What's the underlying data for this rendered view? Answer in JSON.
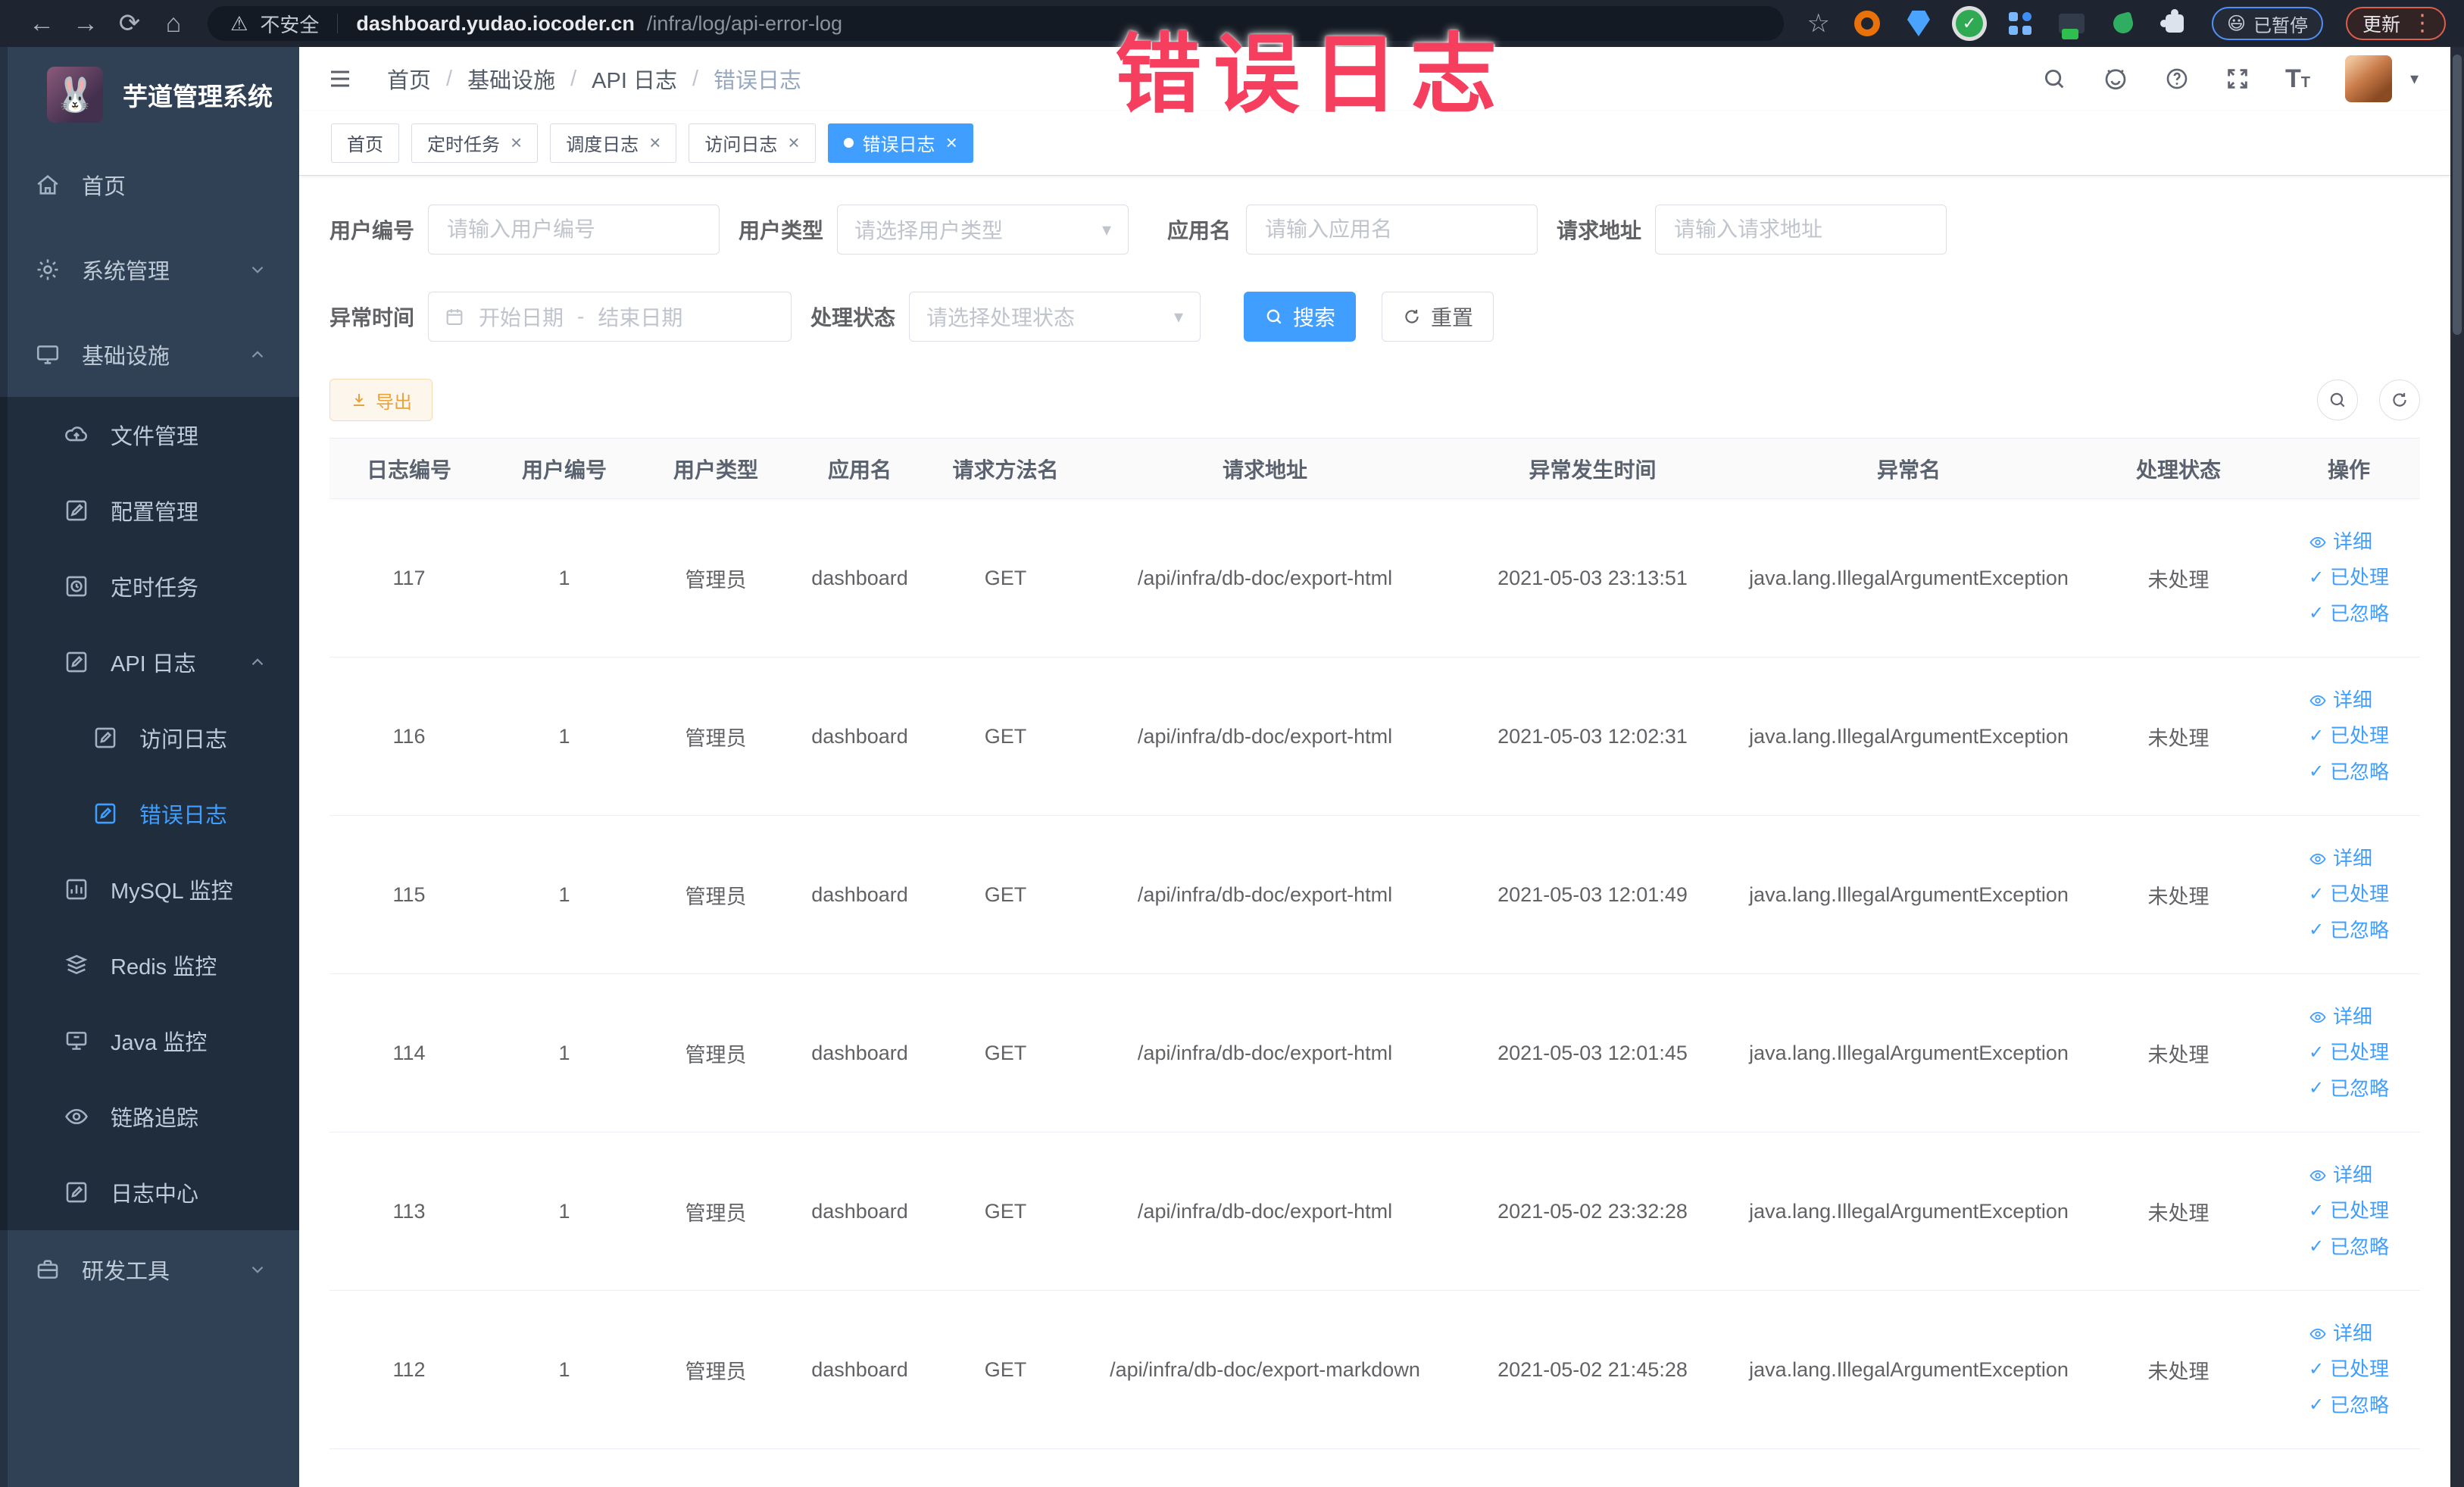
{
  "browser": {
    "security_label": "不安全",
    "url_host": "dashboard.yudao.iocoder.cn",
    "url_path": "/infra/log/api-error-log",
    "paused_emoji": "😃",
    "paused_label": "已暂停",
    "update_label": "更新"
  },
  "icons": {
    "nav_back": "←",
    "nav_forward": "→",
    "nav_reload": "⟳",
    "nav_home": "⌂",
    "security_warning": "⚠",
    "bookmark_star": "☆",
    "menu_kebab": "⋮",
    "dropdown_caret": "▾",
    "close": "×",
    "check": "✓",
    "breadcrumb_separator": "/"
  },
  "annotation": {
    "text": "错误日志",
    "color": "#f63e5e"
  },
  "header": {
    "breadcrumbs": [
      "首页",
      "基础设施",
      "API 日志",
      "错误日志"
    ],
    "font_size_glyph_big": "T",
    "font_size_glyph_small": "T"
  },
  "tabs": [
    {
      "label": "首页",
      "closable": false,
      "active": false
    },
    {
      "label": "定时任务",
      "closable": true,
      "active": false
    },
    {
      "label": "调度日志",
      "closable": true,
      "active": false
    },
    {
      "label": "访问日志",
      "closable": true,
      "active": false
    },
    {
      "label": "错误日志",
      "closable": true,
      "active": true
    }
  ],
  "sidebar": {
    "title": "芋道管理系统",
    "logo_emoji": "🐰",
    "items": [
      {
        "label": "首页"
      },
      {
        "label": "系统管理"
      },
      {
        "label": "基础设施"
      },
      {
        "label": "文件管理"
      },
      {
        "label": "配置管理"
      },
      {
        "label": "定时任务"
      },
      {
        "label": "API 日志"
      },
      {
        "label": "访问日志"
      },
      {
        "label": "错误日志"
      },
      {
        "label": "MySQL 监控"
      },
      {
        "label": "Redis 监控"
      },
      {
        "label": "Java 监控"
      },
      {
        "label": "链路追踪"
      },
      {
        "label": "日志中心"
      },
      {
        "label": "研发工具"
      }
    ]
  },
  "filters": {
    "user_id": {
      "label": "用户编号",
      "placeholder": "请输入用户编号"
    },
    "user_type": {
      "label": "用户类型",
      "placeholder": "请选择用户类型"
    },
    "app_name": {
      "label": "应用名",
      "placeholder": "请输入应用名"
    },
    "request_url": {
      "label": "请求地址",
      "placeholder": "请输入请求地址"
    },
    "exception_time": {
      "label": "异常时间",
      "start_placeholder": "开始日期",
      "separator": "-",
      "end_placeholder": "结束日期"
    },
    "process_status": {
      "label": "处理状态",
      "placeholder": "请选择处理状态"
    },
    "search_label": "搜索",
    "reset_label": "重置"
  },
  "toolbar": {
    "export_label": "导出"
  },
  "table": {
    "columns": [
      "日志编号",
      "用户编号",
      "用户类型",
      "应用名",
      "请求方法名",
      "请求地址",
      "异常发生时间",
      "异常名",
      "处理状态",
      "操作"
    ],
    "actions": [
      "详细",
      "已处理",
      "已忽略"
    ],
    "rows": [
      {
        "id": "117",
        "user_id": "1",
        "user_type": "管理员",
        "app": "dashboard",
        "method": "GET",
        "url": "/api/infra/db-doc/export-html",
        "time": "2021-05-03 23:13:51",
        "exception": "java.lang.IllegalArgumentException",
        "status": "未处理"
      },
      {
        "id": "116",
        "user_id": "1",
        "user_type": "管理员",
        "app": "dashboard",
        "method": "GET",
        "url": "/api/infra/db-doc/export-html",
        "time": "2021-05-03 12:02:31",
        "exception": "java.lang.IllegalArgumentException",
        "status": "未处理"
      },
      {
        "id": "115",
        "user_id": "1",
        "user_type": "管理员",
        "app": "dashboard",
        "method": "GET",
        "url": "/api/infra/db-doc/export-html",
        "time": "2021-05-03 12:01:49",
        "exception": "java.lang.IllegalArgumentException",
        "status": "未处理"
      },
      {
        "id": "114",
        "user_id": "1",
        "user_type": "管理员",
        "app": "dashboard",
        "method": "GET",
        "url": "/api/infra/db-doc/export-html",
        "time": "2021-05-03 12:01:45",
        "exception": "java.lang.IllegalArgumentException",
        "status": "未处理"
      },
      {
        "id": "113",
        "user_id": "1",
        "user_type": "管理员",
        "app": "dashboard",
        "method": "GET",
        "url": "/api/infra/db-doc/export-html",
        "time": "2021-05-02 23:32:28",
        "exception": "java.lang.IllegalArgumentException",
        "status": "未处理"
      },
      {
        "id": "112",
        "user_id": "1",
        "user_type": "管理员",
        "app": "dashboard",
        "method": "GET",
        "url": "/api/infra/db-doc/export-markdown",
        "time": "2021-05-02 21:45:28",
        "exception": "java.lang.IllegalArgumentException",
        "status": "未处理"
      }
    ]
  },
  "colors": {
    "primary": "#409EFF",
    "warning": "#E6A23C",
    "sidebar_bg": "#304156",
    "submenu_bg": "#1f2d3d",
    "annotation": "#f63e5e"
  }
}
